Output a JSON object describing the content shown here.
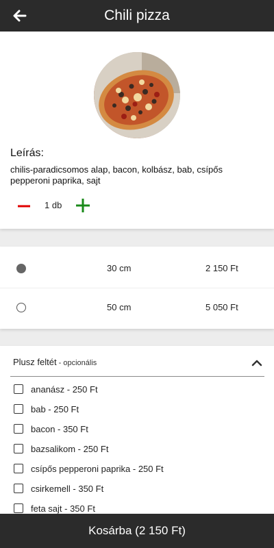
{
  "header": {
    "title": "Chili pizza",
    "back_icon": "arrow-left-icon"
  },
  "product": {
    "image_icon": "pizza-image",
    "description_label": "Leírás:",
    "description": "chilis-paradicsomos alap, bacon, kolbász, bab, csípős pepperoni paprika, sajt",
    "quantity": "1 db",
    "minus_color": "#e00000",
    "plus_color": "#1a8a1a"
  },
  "sizes": [
    {
      "name": "30 cm",
      "price": "2 150 Ft",
      "selected": true
    },
    {
      "name": "50 cm",
      "price": "5 050 Ft",
      "selected": false
    }
  ],
  "extras": {
    "title": "Plusz feltét",
    "optional_suffix": " - opcionális",
    "items": [
      "ananász - 250 Ft",
      "bab - 250 Ft",
      "bacon - 350 Ft",
      "bazsalikom - 250 Ft",
      "csípős pepperoni paprika - 250 Ft",
      "csirkemell - 350 Ft",
      "feta sajt - 350 Ft"
    ]
  },
  "cart": {
    "label": "Kosárba (2 150 Ft)"
  }
}
